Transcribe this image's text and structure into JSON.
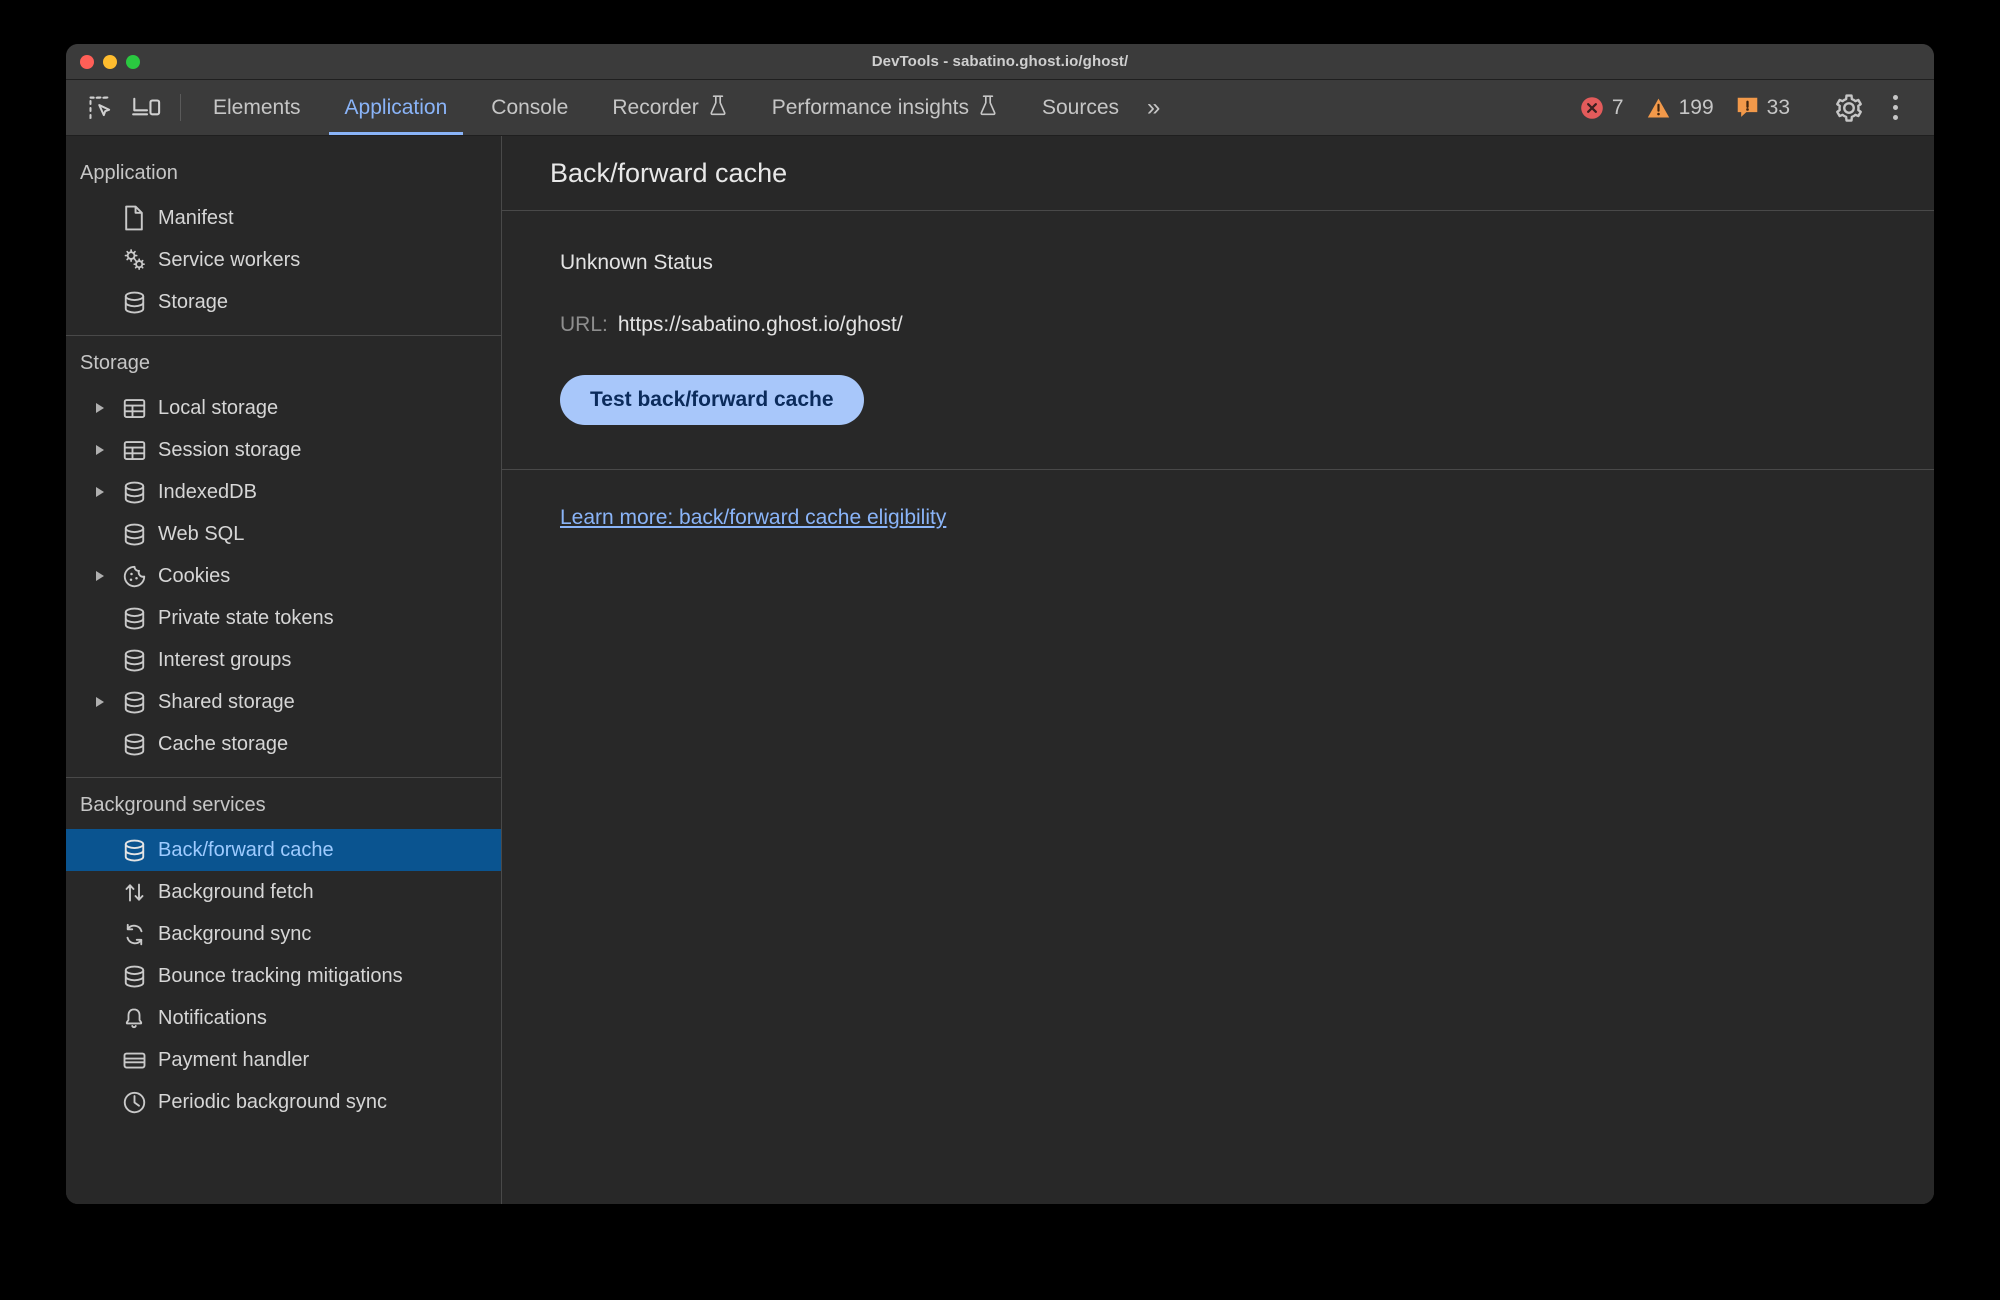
{
  "window": {
    "title": "DevTools - sabatino.ghost.io/ghost/",
    "controls": [
      "close",
      "minimize",
      "maximize"
    ]
  },
  "toolbar": {
    "left_icons": [
      {
        "name": "inspect-element-icon",
        "label": "Inspect element"
      },
      {
        "name": "device-toolbar-icon",
        "label": "Toggle device toolbar"
      }
    ],
    "tabs": [
      {
        "label": "Elements",
        "selected": false,
        "badge": ""
      },
      {
        "label": "Application",
        "selected": true,
        "badge": ""
      },
      {
        "label": "Console",
        "selected": false,
        "badge": ""
      },
      {
        "label": "Recorder",
        "selected": false,
        "badge": "flask-icon"
      },
      {
        "label": "Performance insights",
        "selected": false,
        "badge": "flask-icon"
      },
      {
        "label": "Sources",
        "selected": false,
        "badge": ""
      }
    ],
    "more_tabs_label": "»",
    "counters": [
      {
        "name": "errors",
        "icon": "error-icon",
        "value": "7",
        "color": "#e35b5b"
      },
      {
        "name": "warnings",
        "icon": "warning-icon",
        "value": "199",
        "color": "#f2994a"
      },
      {
        "name": "issues",
        "icon": "issue-icon",
        "value": "33",
        "color": "#f2994a"
      }
    ],
    "settings_label": "Settings",
    "menu_label": "Customize and control DevTools"
  },
  "sidebar": {
    "groups": [
      {
        "title": "Application",
        "items": [
          {
            "label": "Manifest",
            "icon": "document-icon",
            "twisty": false,
            "selected": false
          },
          {
            "label": "Service workers",
            "icon": "gears-icon",
            "twisty": false,
            "selected": false
          },
          {
            "label": "Storage",
            "icon": "database-icon",
            "twisty": false,
            "selected": false
          }
        ]
      },
      {
        "title": "Storage",
        "items": [
          {
            "label": "Local storage",
            "icon": "table-icon",
            "twisty": true,
            "selected": false
          },
          {
            "label": "Session storage",
            "icon": "table-icon",
            "twisty": true,
            "selected": false
          },
          {
            "label": "IndexedDB",
            "icon": "database-icon",
            "twisty": true,
            "selected": false
          },
          {
            "label": "Web SQL",
            "icon": "database-icon",
            "twisty": false,
            "selected": false
          },
          {
            "label": "Cookies",
            "icon": "cookie-icon",
            "twisty": true,
            "selected": false
          },
          {
            "label": "Private state tokens",
            "icon": "database-icon",
            "twisty": false,
            "selected": false
          },
          {
            "label": "Interest groups",
            "icon": "database-icon",
            "twisty": false,
            "selected": false
          },
          {
            "label": "Shared storage",
            "icon": "database-icon",
            "twisty": true,
            "selected": false
          },
          {
            "label": "Cache storage",
            "icon": "database-icon",
            "twisty": false,
            "selected": false
          }
        ]
      },
      {
        "title": "Background services",
        "items": [
          {
            "label": "Back/forward cache",
            "icon": "database-icon",
            "twisty": false,
            "selected": true
          },
          {
            "label": "Background fetch",
            "icon": "arrows-updown-icon",
            "twisty": false,
            "selected": false
          },
          {
            "label": "Background sync",
            "icon": "sync-icon",
            "twisty": false,
            "selected": false
          },
          {
            "label": "Bounce tracking mitigations",
            "icon": "database-icon",
            "twisty": false,
            "selected": false
          },
          {
            "label": "Notifications",
            "icon": "bell-icon",
            "twisty": false,
            "selected": false
          },
          {
            "label": "Payment handler",
            "icon": "card-icon",
            "twisty": false,
            "selected": false
          },
          {
            "label": "Periodic background sync",
            "icon": "clock-icon",
            "twisty": false,
            "selected": false
          }
        ]
      }
    ]
  },
  "main": {
    "title": "Back/forward cache",
    "status": "Unknown Status",
    "url_label": "URL:",
    "url_value": "https://sabatino.ghost.io/ghost/",
    "test_button": "Test back/forward cache",
    "learn_more_link": "Learn more: back/forward cache eligibility"
  },
  "colors": {
    "accent_blue": "#8ab4f8",
    "selected_row_bg": "#0a5490",
    "selected_row_text": "#9ecbff",
    "button_bg": "#a8c7fa",
    "button_text": "#0b2b5b",
    "panel_bg": "#282828",
    "toolbar_bg": "#3b3b3b",
    "error_red": "#e35b5b",
    "warning_orange": "#f2994a"
  }
}
